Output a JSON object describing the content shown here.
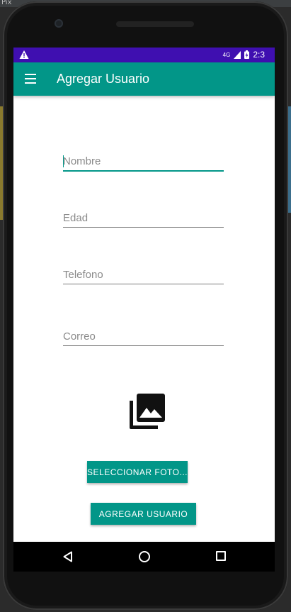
{
  "ide": {
    "window_title_fragment": "Pix"
  },
  "status_bar": {
    "network_label": "4G",
    "time": "2:3",
    "icons": [
      "warning-icon",
      "signal-icon",
      "battery-icon"
    ]
  },
  "app_bar": {
    "title": "Agregar Usuario",
    "menu_icon": "menu-icon"
  },
  "form": {
    "nombre": {
      "placeholder": "Nombre",
      "value": ""
    },
    "edad": {
      "placeholder": "Edad",
      "value": ""
    },
    "telefono": {
      "placeholder": "Telefono",
      "value": ""
    },
    "correo": {
      "placeholder": "Correo",
      "value": ""
    }
  },
  "photo": {
    "icon": "photo-library-icon"
  },
  "buttons": {
    "select_photo": "SELECCIONAR FOTO...",
    "add_user": "AGREGAR USUARIO"
  },
  "colors": {
    "status_bar": "#3f0fb0",
    "primary": "#029688",
    "screen_bg": "#ffffff"
  }
}
